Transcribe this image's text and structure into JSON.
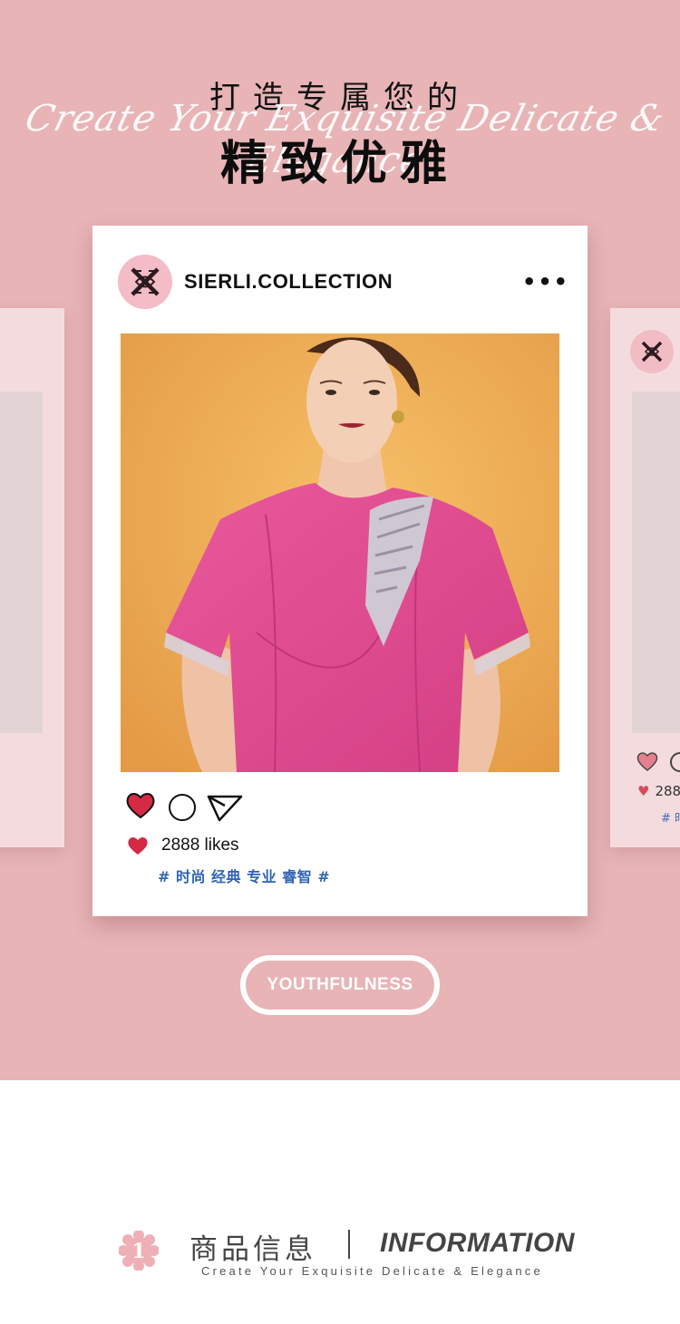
{
  "hero": {
    "title_small": "打造专属您的",
    "script_text": "Create Your Exquisite Delicate & Elegance",
    "title_big": "精致优雅",
    "background_color": "#e8b4b6"
  },
  "post": {
    "account_name": "SIERLI.COLLECTION",
    "more_glyph": "•••",
    "likes_text": "2888 likes",
    "hashtags": "# 时尚 经典 专业 睿智 #",
    "logo_icon": "brand-monogram-icon",
    "photo_description_icon": "model-photo"
  },
  "side_card_right": {
    "likes_fragment": "288",
    "tag_fragment": "# 时"
  },
  "badge": {
    "label": "YOUTHFULNESS"
  },
  "info": {
    "number": "1",
    "title_cn": "商品信息",
    "title_en": "INFORMATION",
    "subtitle": "Create Your Exquisite Delicate & Elegance"
  },
  "colors": {
    "accent_pink": "#e8b4b6",
    "heart_red": "#d42a44",
    "hashtag_blue": "#2f63b3",
    "badge_pink": "#eeb0b6"
  }
}
